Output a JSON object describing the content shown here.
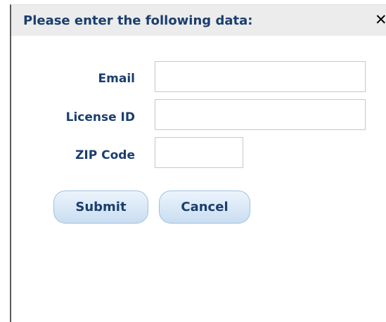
{
  "dialog": {
    "title": "Please enter the following data:",
    "close_glyph": "✕"
  },
  "form": {
    "fields": [
      {
        "label": "Email",
        "value": "",
        "placeholder": ""
      },
      {
        "label": "License ID",
        "value": "",
        "placeholder": ""
      },
      {
        "label": "ZIP Code",
        "value": "",
        "placeholder": ""
      }
    ]
  },
  "actions": {
    "submit_label": "Submit",
    "cancel_label": "Cancel"
  }
}
